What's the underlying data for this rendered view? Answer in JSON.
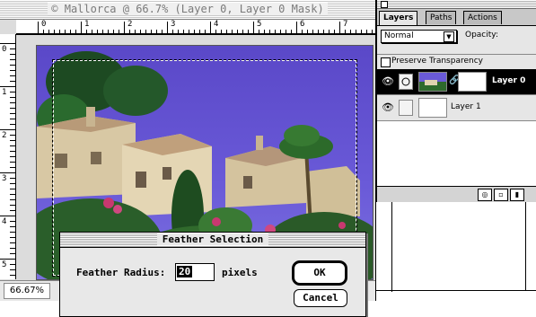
{
  "document": {
    "title": "© Mallorca @ 66.7% (Layer 0, Layer 0 Mask)",
    "zoom_readout": "66.67%",
    "ruler_h_labels": [
      "0",
      "1",
      "2",
      "3",
      "4",
      "5",
      "6",
      "7"
    ],
    "ruler_v_labels": [
      "0",
      "1",
      "2",
      "3",
      "4",
      "5"
    ]
  },
  "layers_palette": {
    "tabs": [
      {
        "label": "Layers",
        "active": true
      },
      {
        "label": "Paths",
        "active": false
      },
      {
        "label": "Actions",
        "active": false
      }
    ],
    "blend_mode": "Normal",
    "opacity_label": "Opacity:",
    "preserve_transparency_label": "Preserve Transparency",
    "layers": [
      {
        "name": "Layer 0",
        "selected": true,
        "has_mask": true
      },
      {
        "name": "Layer 1",
        "selected": false,
        "has_mask": false
      }
    ]
  },
  "dialog": {
    "title": "Feather Selection",
    "radius_label": "Feather Radius:",
    "radius_value": "20",
    "units": "pixels",
    "ok_label": "OK",
    "cancel_label": "Cancel"
  }
}
